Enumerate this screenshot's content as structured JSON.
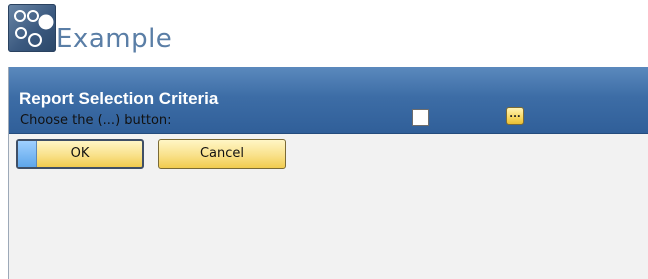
{
  "header": {
    "title": "Example",
    "icon": "sap-b1-logo-icon"
  },
  "dialog": {
    "title": "Report Selection Criteria",
    "field_label": "Choose the (...) button:",
    "checkbox_checked": false,
    "browse_button_label": "...",
    "ok_label": "OK",
    "cancel_label": "Cancel"
  },
  "colors": {
    "titlebar": "#3d6da6",
    "button_fill": "#f9e18a",
    "example_text": "#5a7ea6"
  }
}
